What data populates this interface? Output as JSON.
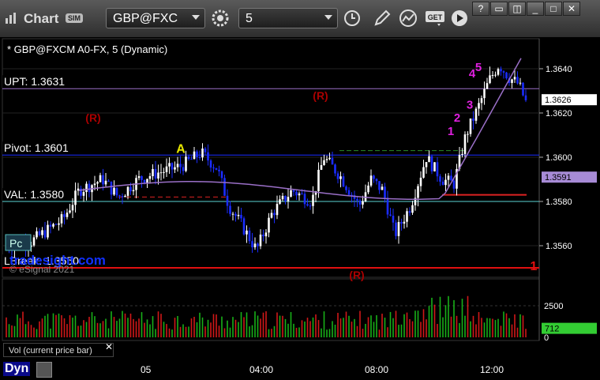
{
  "toolbar": {
    "app_title": "Chart",
    "sim_badge": "SIM",
    "symbol": "GBP@FXC",
    "interval": "5",
    "get_label": "GET"
  },
  "colors": {
    "up_candle": "#ffffff",
    "down_candle": "#1a2cff",
    "upt_line": "#9a6fc7",
    "pivot_line": "#1a2cff",
    "val_line": "#5bd3d3",
    "break_line": "#e01010",
    "price_badge": "#ffffff",
    "vwap_badge": "#a78bd6",
    "vol_badge": "#33cc33"
  },
  "chart_data": {
    "type": "candlestick",
    "title": "* GBP@FXCM A0-FX, 5 (Dynamic)",
    "ylim": [
      1.3545,
      1.3652
    ],
    "yticks": [
      "1.3640",
      "1.3620",
      "1.3600",
      "1.3580",
      "1.3560"
    ],
    "level_lines": [
      {
        "label": "UPT: 1.3631",
        "value": 1.3631
      },
      {
        "label": "Pivot: 1.3601",
        "value": 1.3601
      },
      {
        "label": "VAL: 1.3580",
        "value": 1.358
      },
      {
        "label": "LBreak: 1.3550",
        "value": 1.355
      }
    ],
    "last_price": "1.3626",
    "vwap_value": "1.3591",
    "xticks": [
      "05",
      "04:00",
      "08:00",
      "12:00"
    ],
    "annotations": [
      "(R)",
      "(R)",
      "(R)",
      "A",
      "1",
      "2",
      "3",
      "4",
      "5",
      "1"
    ],
    "watermark": "tradesight.com",
    "copyright": "© eSignal 2021",
    "pc_label": "Pc",
    "volume": {
      "label": "Vol (current price bar)",
      "yticks": [
        "2500",
        "0"
      ],
      "last_value": "712"
    }
  },
  "footer": {
    "dyn_label": "Dyn"
  }
}
